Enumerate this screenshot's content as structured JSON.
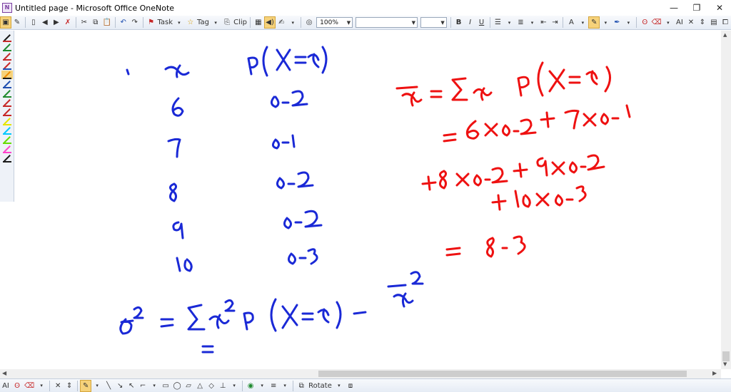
{
  "window": {
    "title": "Untitled page - Microsoft Office OneNote",
    "minimize": "—",
    "restore": "❐",
    "close": "✕"
  },
  "toolbar": {
    "task_label": "Task",
    "tag_label": "Tag",
    "clip_label": "Clip",
    "zoom_value": "100%",
    "font_value": "",
    "size_value": "",
    "bold": "B",
    "italic": "I",
    "underline": "U"
  },
  "bottombar": {
    "rotate_label": "Rotate"
  },
  "colors": {
    "blue_ink": "#1a29d6",
    "red_ink": "#ee1111",
    "active_tool": "#f6d27a"
  },
  "pens": [
    {
      "color": "#1a1a1a",
      "under": "#c62828"
    },
    {
      "color": "#1f8a2e",
      "under": "#1f8a2e"
    },
    {
      "color": "#c62828",
      "under": "#c62828"
    },
    {
      "color": "#c62828",
      "under": "#1f4fb0"
    },
    {
      "color": "#ef8a00",
      "under": "#1a1a1a",
      "active": true
    },
    {
      "color": "#1f4fb0",
      "under": "#1f4fb0"
    },
    {
      "color": "#1f8a2e",
      "under": "#1f8a2e"
    },
    {
      "color": "#c62828",
      "under": "#c62828"
    },
    {
      "color": "#c62828",
      "under": "#c62828"
    },
    {
      "color": "#e5e500",
      "under": "#e5e500"
    },
    {
      "color": "#00c8ff",
      "under": "#00c8ff"
    },
    {
      "color": "#66dd00",
      "under": "#66dd00"
    },
    {
      "color": "#ff44cc",
      "under": "#ff44cc"
    },
    {
      "color": "#1a1a1a",
      "under": "#1a1a1a"
    }
  ]
}
